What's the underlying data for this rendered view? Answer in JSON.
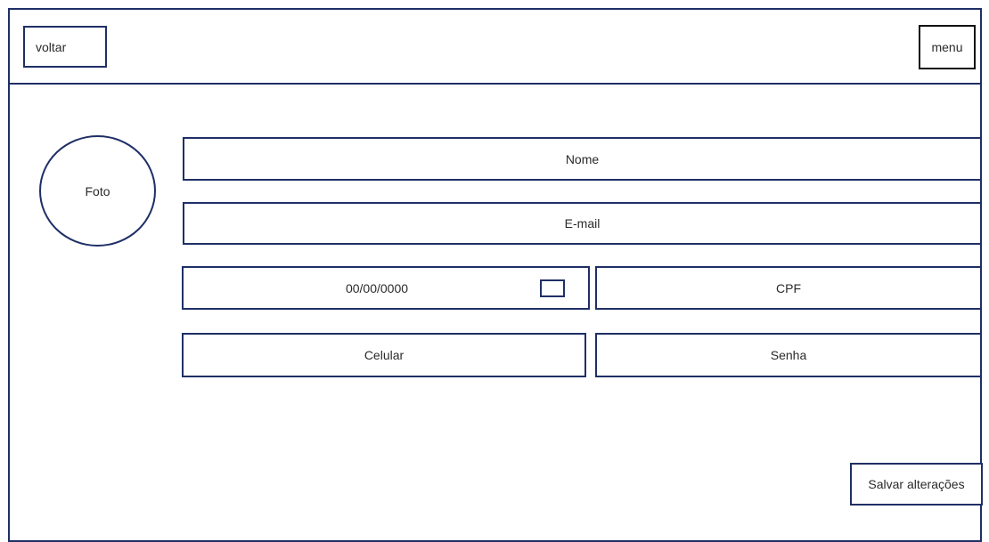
{
  "header": {
    "back_label": "voltar",
    "menu_label": "menu"
  },
  "profile": {
    "photo_label": "Foto"
  },
  "form": {
    "name_placeholder": "Nome",
    "email_placeholder": "E-mail",
    "birthdate_value": "00/00/0000",
    "cpf_placeholder": "CPF",
    "phone_placeholder": "Celular",
    "password_placeholder": "Senha",
    "calendar_icon": "calendar-icon"
  },
  "actions": {
    "save_label": "Salvar alterações"
  },
  "colors": {
    "border": "#1f2f66",
    "menu_border": "#111111",
    "background": "#ffffff"
  }
}
